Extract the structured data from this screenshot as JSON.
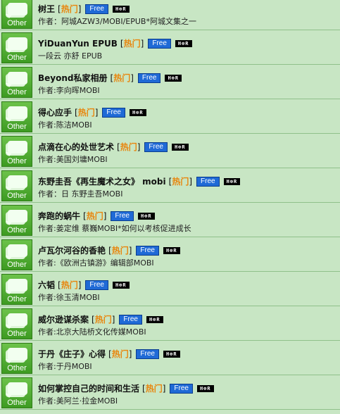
{
  "category_label": "Other",
  "hot_label": "热门",
  "free_label": "Free",
  "hr_label": "H⊗R",
  "items": [
    {
      "title": "树王",
      "author": "作者：阿城AZW3/MOBI/EPUB*阿城文集之一"
    },
    {
      "title": "YiDuanYun EPUB",
      "author": "一段云 亦舒 EPUB"
    },
    {
      "title": "Beyond私家相册",
      "author": "作者:李向晖MOBI"
    },
    {
      "title": "得心应手",
      "author": "作者:陈洁MOBI"
    },
    {
      "title": "点滴在心的处世艺术",
      "author": "作者:美国刘墉MOBI"
    },
    {
      "title": "东野圭吾《再生魔术之女》 mobi",
      "author": "作者：日 东野圭吾MOBI"
    },
    {
      "title": "奔跑的蜗牛",
      "author": "作者:姜定维 蔡巍MOBI*如何以考核促进成长"
    },
    {
      "title": "卢瓦尔河谷的香艳",
      "author": "作者:《欧洲古镇游》编辑部MOBI"
    },
    {
      "title": "六韬",
      "author": "作者:徐玉清MOBI"
    },
    {
      "title": "威尔逊谋杀案",
      "author": "作者:北京大陆桥文化传媒MOBI"
    },
    {
      "title": "于丹《庄子》心得",
      "author": "作者:于丹MOBI"
    },
    {
      "title": "如何掌控自己的时间和生活",
      "author": "作者:美阿兰·拉金MOBI"
    }
  ]
}
